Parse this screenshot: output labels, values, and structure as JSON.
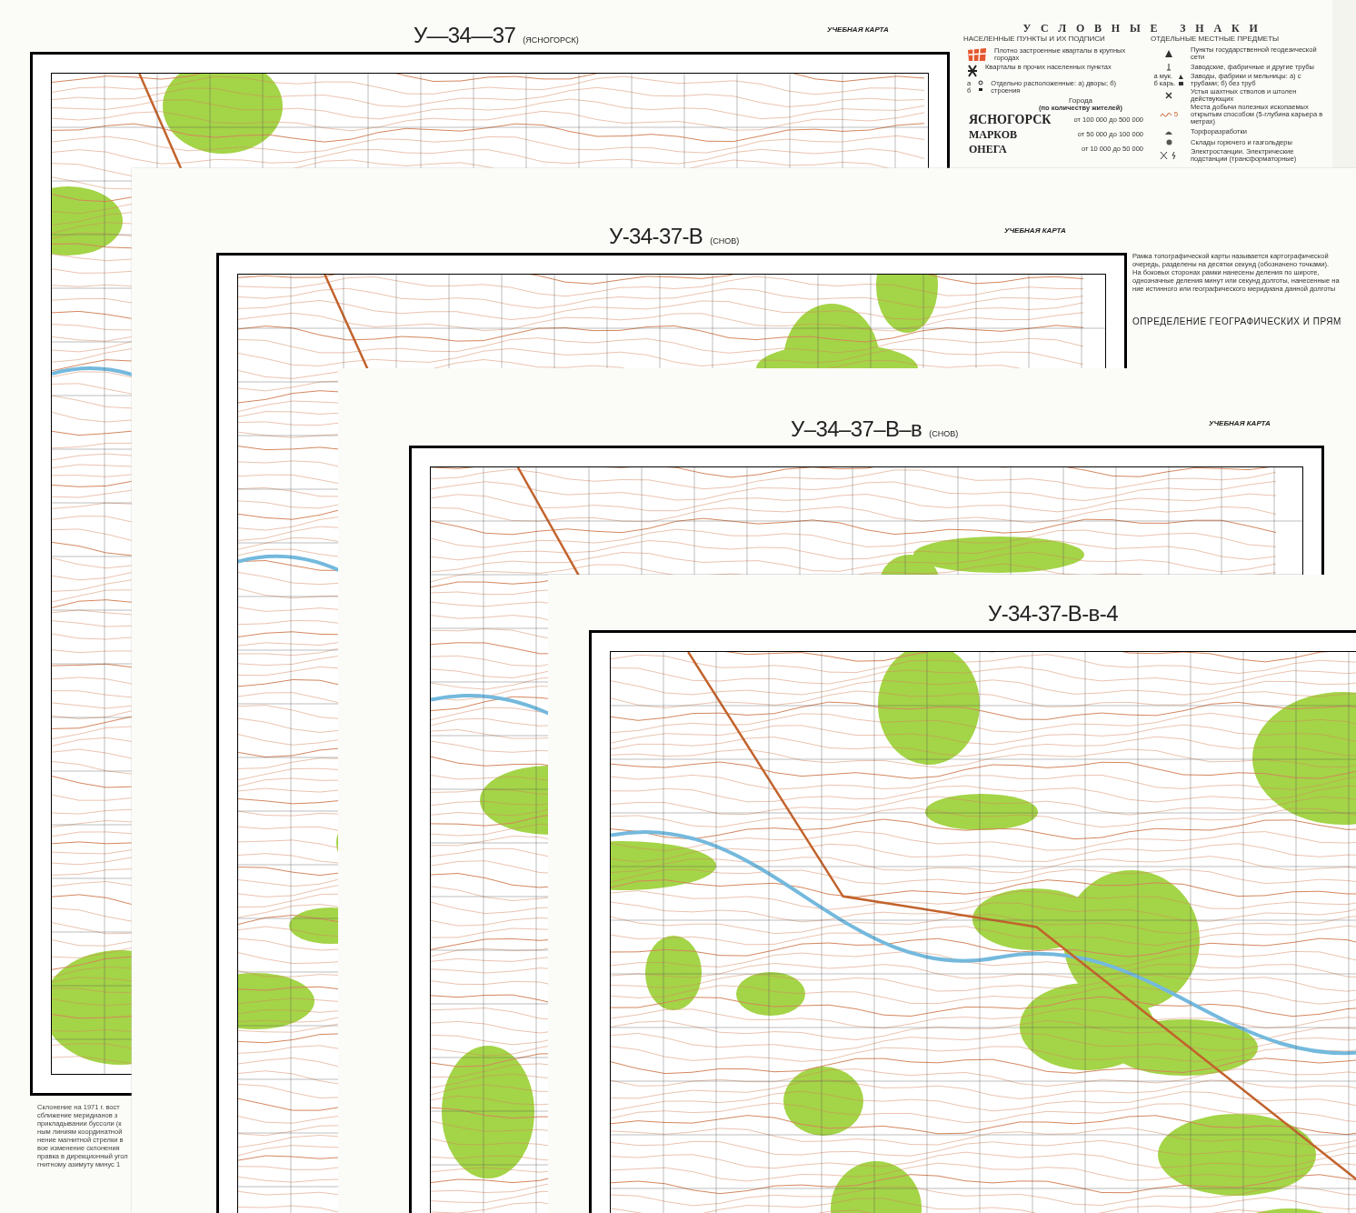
{
  "sheets": [
    {
      "title": "У—34—37",
      "subtitle": "(ЯСНОГОРСК)",
      "label": "УЧЕБНАЯ КАРТА"
    },
    {
      "title": "У-34-37-В",
      "subtitle": "(СНОВ)",
      "label": "УЧЕБНАЯ КАРТА"
    },
    {
      "title": "У–34–37–В–в",
      "subtitle": "(СНОВ)",
      "label": "УЧЕБНАЯ КАРТА"
    },
    {
      "title": "У-34-37-В-в-4"
    }
  ],
  "legend": {
    "heading": "УСЛОВНЫЕ  ЗНАКИ",
    "left": {
      "title": "НАСЕЛЕННЫЕ ПУНКТЫ И ИХ ПОДПИСИ",
      "items": [
        {
          "kind": "blocks",
          "text": "Плотно застроенные кварталы в крупных городах"
        },
        {
          "kind": "quarters",
          "text": "Кварталы в прочих населенных пунктах"
        },
        {
          "kind": "yards",
          "tags": [
            "а",
            "б"
          ],
          "text": "Отдельно расположенные: а) дворы; б) строения"
        }
      ],
      "cities_title": "Города",
      "cities_note": "(по количеству жителей)",
      "cities": [
        {
          "name": "ЯСНОГОРСК",
          "range": "от 100 000 до 500 000"
        },
        {
          "name": "МАРКОВ",
          "range": "от 50 000 до 100 000"
        },
        {
          "name": "ОНЕГА",
          "range": "от 10 000 до 50 000"
        }
      ]
    },
    "right": {
      "title": "ОТДЕЛЬНЫЕ МЕСТНЫЕ ПРЕДМЕТЫ",
      "items": [
        {
          "kind": "geodetic",
          "text": "Пункты государственной геодезической сети"
        },
        {
          "kind": "chimney",
          "text": "Заводские, фабричные и другие трубы"
        },
        {
          "kind": "factory",
          "tags": [
            "а мук.",
            "б карь."
          ],
          "text": "Заводы, фабрики и мельницы: а) с трубами; б) без труб"
        },
        {
          "kind": "mine",
          "text": "Устья шахтных стволов и штолен действующих"
        },
        {
          "kind": "quarry",
          "tag": "5",
          "text": "Места добычи полезных ископаемых открытым способом (5-глубина карьера в метрах)"
        },
        {
          "kind": "peat",
          "text": "Торфоразработки"
        },
        {
          "kind": "tank",
          "text": "Склады горючего и газгольдеры"
        },
        {
          "kind": "power",
          "text": "Электростанции. Электрические подстанции (трансформаторные)"
        }
      ]
    }
  },
  "declination_note": [
    "Склонение на 1971 г. вост",
    "сближение меридианов з",
    "прикладывании буссоли (к",
    "ным линиям координатной",
    "нение магнитной стрелки в",
    "вое изменение склонения",
    "правка в дирекционный угол",
    "гнитному азимуту минус 1"
  ],
  "frame_note": {
    "lines": [
      "Рамка топографической карты называется картографической",
      "очередь, разделены на десятки секунд (обозначено точками).",
      "На боковых сторонах рамки нанесены деления по широте,",
      "однозначные деления минут или секунд долготы, нанесенные на",
      "ние истинного или географического меридиана данной долготы"
    ],
    "heading": "ОПРЕДЕЛЕНИЕ ГЕОГРАФИЧЕСКИХ И ПРЯМ"
  }
}
